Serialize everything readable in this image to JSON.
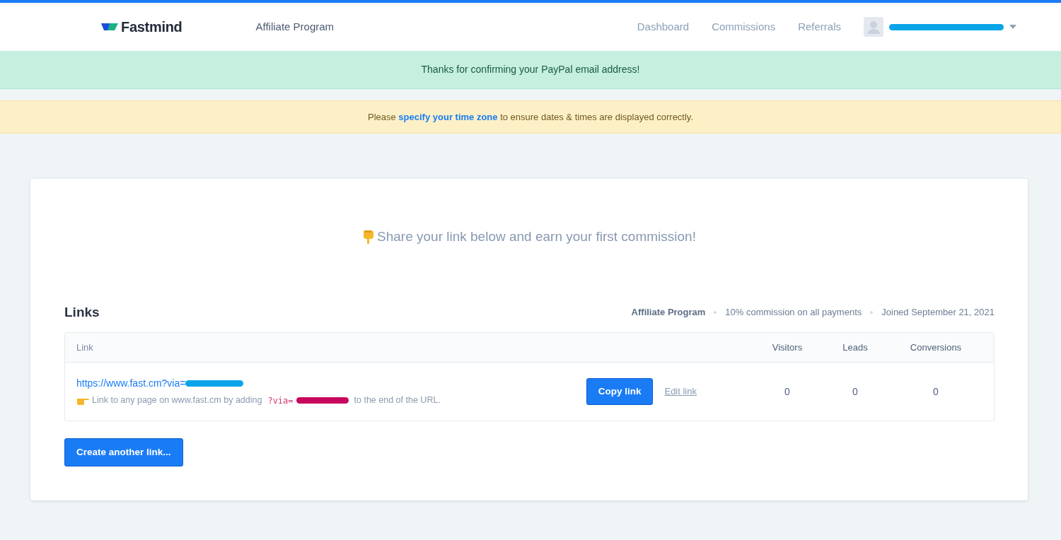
{
  "navbar": {
    "brand": "Fastmind",
    "program": "Affiliate Program",
    "links": [
      {
        "label": "Dashboard"
      },
      {
        "label": "Commissions"
      },
      {
        "label": "Referrals"
      }
    ]
  },
  "alerts": [
    {
      "kind": "success",
      "parts": [
        {
          "text": "Thanks for confirming your PayPal email address!"
        }
      ]
    },
    {
      "kind": "warning",
      "parts": [
        {
          "text": "Please "
        },
        {
          "text": "specify your time zone",
          "link": true
        },
        {
          "text": " to ensure dates & times are displayed correctly."
        }
      ]
    }
  ],
  "card": {
    "headline": "Share your link below and earn your first commission!",
    "links_title": "Links",
    "meta": [
      "Affiliate Program",
      "10% commission on all payments",
      "Joined September 21, 2021"
    ],
    "table": {
      "columns": [
        "Link",
        "Visitors",
        "Leads",
        "Conversions"
      ],
      "rows": [
        {
          "url": "https://www.fast.cm?via=",
          "hint_before": "Link to any page on www.fast.cm by adding",
          "hint_code": "?via=",
          "hint_after": "to the end of the URL.",
          "copy_button": "Copy link",
          "edit_link": "Edit link",
          "visitors": "0",
          "leads": "0",
          "conversions": "0"
        }
      ]
    },
    "create_button": "Create another link..."
  }
}
